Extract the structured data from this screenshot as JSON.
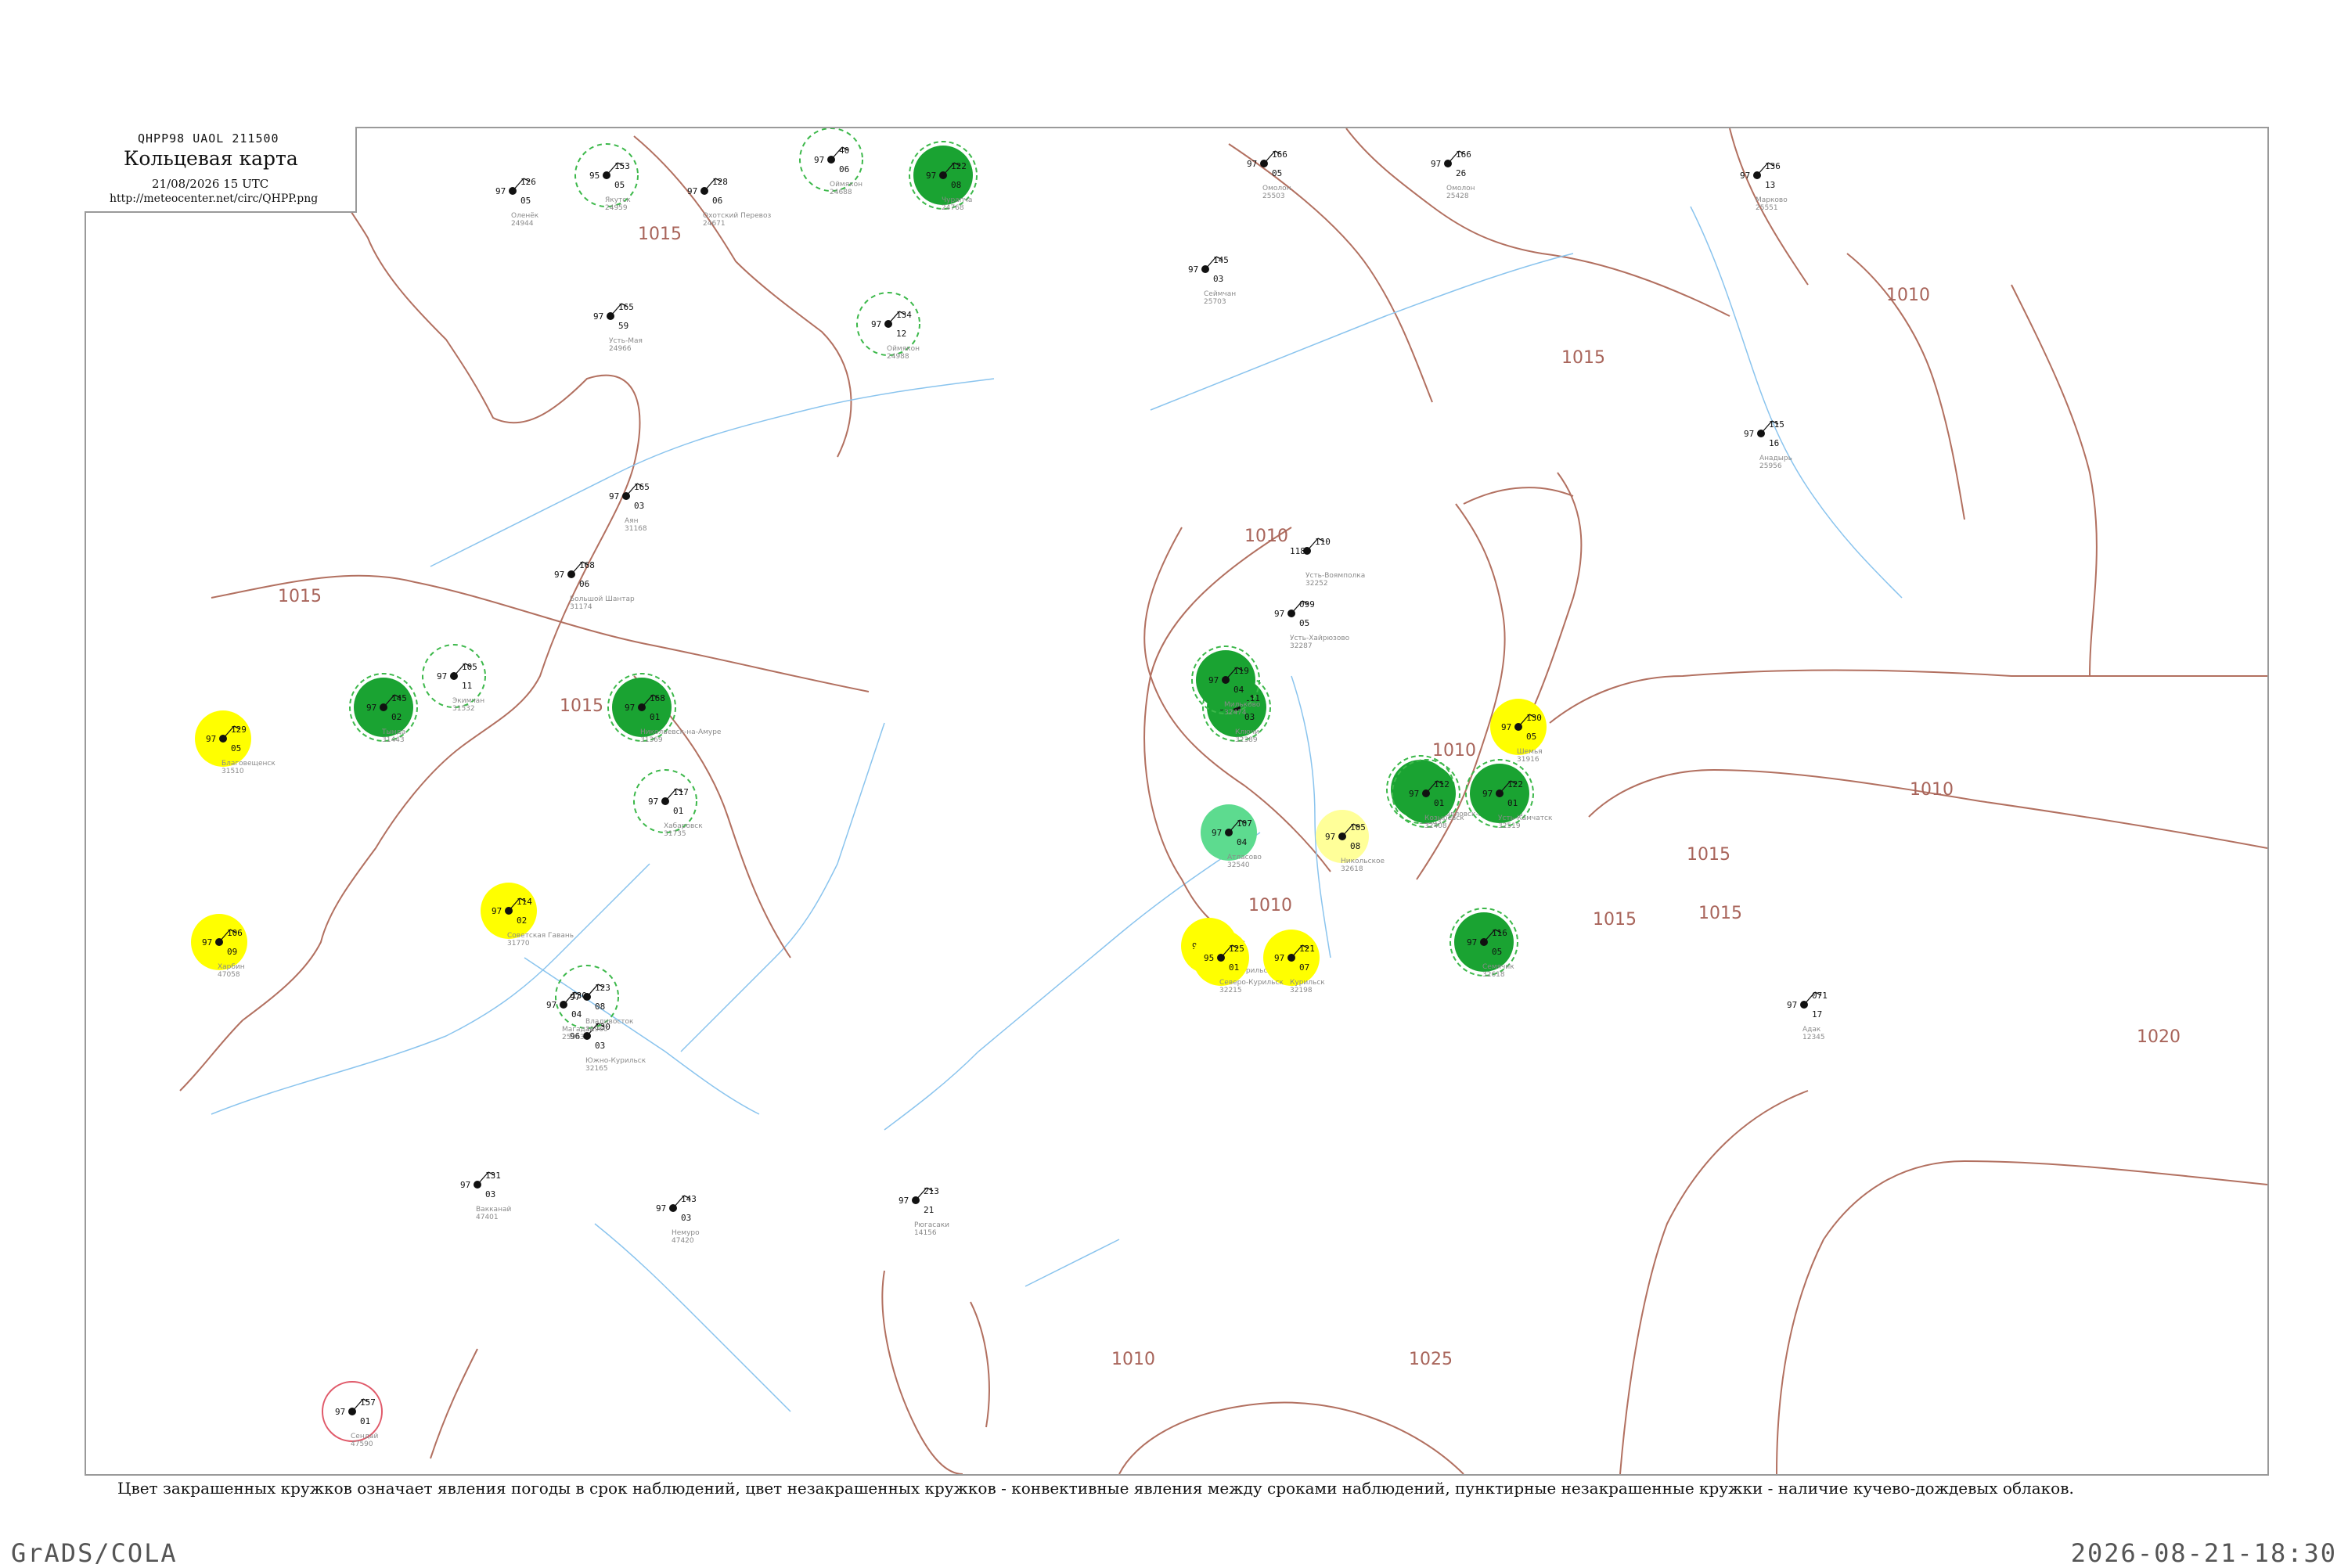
{
  "header": {
    "code_line": "QHPP98  UAOL  211500",
    "title": "Кольцевая карта",
    "datetime": "21/08/2026 15 UTC",
    "url": "http://meteocenter.net/circ/QHPP.png"
  },
  "caption": "Цвет закрашенных кружков означает явления погоды в срок наблюдений, цвет незакрашенных кружков - конвективные явления между сроками наблюдений, пунктирные незакрашенные кружки - наличие кучево-дождевых облаков.",
  "footer": {
    "left": "GrADS/COLA",
    "right": "2026-08-21-18:30"
  },
  "colors": {
    "isobar": "#b27060",
    "coast": "#b27060",
    "river": "#8ac4ee",
    "thunder_green": "#1aa332",
    "light_green": "#5ddb8f",
    "yellow": "#ffff00",
    "pale_yellow": "#ffff99",
    "dashed_green": "#3cb84a",
    "red_ring": "#e05a6a"
  },
  "isobar_labels": [
    {
      "text": "1015"
    },
    {
      "text": "1015"
    },
    {
      "text": "1010"
    },
    {
      "text": "1015"
    },
    {
      "text": "1010"
    },
    {
      "text": "1015"
    },
    {
      "text": "1010"
    },
    {
      "text": "1010"
    },
    {
      "text": "1015"
    },
    {
      "text": "1020"
    },
    {
      "text": "1025"
    },
    {
      "text": "1010"
    },
    {
      "text": "1010"
    },
    {
      "text": "1015"
    },
    {
      "text": "1015"
    }
  ],
  "stations": [
    {
      "id": "24959",
      "name": "Якутск",
      "marker": "dashed",
      "v": [
        "153",
        "95",
        "05"
      ]
    },
    {
      "id": "24944",
      "name": "Оленёк",
      "marker": "none",
      "v": [
        "126",
        "97",
        "05"
      ]
    },
    {
      "id": "24671",
      "name": "Охотский Перевоз",
      "marker": "none",
      "v": [
        "128",
        "97",
        "06"
      ]
    },
    {
      "id": "24688",
      "name": "Оймякон",
      "marker": "dashed",
      "v": [
        "40",
        "97",
        "06"
      ]
    },
    {
      "id": "25503",
      "name": "Омолон",
      "marker": "none",
      "v": [
        "166",
        "97",
        "05"
      ]
    },
    {
      "id": "25428",
      "name": "Омолон",
      "marker": "none",
      "v": [
        "166",
        "97",
        "26"
      ]
    },
    {
      "id": "25551",
      "name": "Марково",
      "marker": "none",
      "v": [
        "136",
        "97",
        "13"
      ]
    },
    {
      "id": "24768",
      "name": "Чурапча",
      "marker": "green",
      "v": [
        "122",
        "97",
        "08"
      ]
    },
    {
      "id": "24966",
      "name": "Усть-Мая",
      "marker": "none",
      "v": [
        "165",
        "97",
        "59"
      ]
    },
    {
      "id": "24988",
      "name": "Оймякон",
      "marker": "dashed",
      "v": [
        "134",
        "97",
        "12"
      ]
    },
    {
      "id": "31168",
      "name": "Аян",
      "marker": "none",
      "v": [
        "165",
        "97",
        "03"
      ]
    },
    {
      "id": "31174",
      "name": "Большой Шантар",
      "marker": "none",
      "v": [
        "168",
        "97",
        "06"
      ]
    },
    {
      "id": "25703",
      "name": "Сеймчан",
      "marker": "none",
      "v": [
        "145",
        "97",
        "03"
      ]
    },
    {
      "id": "32389",
      "name": "Ключи",
      "marker": "green",
      "v": [
        "111",
        "97",
        "03"
      ]
    },
    {
      "id": "32098",
      "name": "Северо-Курильск",
      "marker": "yellow",
      "v": [
        "124",
        "97",
        "07"
      ]
    },
    {
      "id": "31369",
      "name": "Николаевск-на-Амуре",
      "marker": "green",
      "v": [
        "168",
        "97",
        "01"
      ]
    },
    {
      "id": "31770",
      "name": "Советская Гавань",
      "marker": "yellow",
      "v": [
        "114",
        "97",
        "02"
      ]
    },
    {
      "id": "32165",
      "name": "Южно-Курильск",
      "marker": "none",
      "v": [
        "130",
        "96",
        "03"
      ]
    },
    {
      "id": "31510",
      "name": "Благовещенск",
      "marker": "yellow",
      "v": [
        "129",
        "97",
        "05"
      ]
    },
    {
      "id": "31443",
      "name": "Тында",
      "marker": "green",
      "v": [
        "145",
        "97",
        "02"
      ]
    },
    {
      "id": "31532",
      "name": "Экимчан",
      "marker": "dashed",
      "v": [
        "105",
        "97",
        "11"
      ]
    },
    {
      "id": "31735",
      "name": "Хабаровск",
      "marker": "dashed",
      "v": [
        "117",
        "97",
        "01"
      ]
    },
    {
      "id": "31960",
      "name": "Владивосток",
      "marker": "dashed",
      "v": [
        "123",
        "97",
        "08"
      ]
    },
    {
      "id": "47058",
      "name": "Харбин",
      "marker": "yellow",
      "v": [
        "106",
        "97",
        "09"
      ]
    },
    {
      "id": "32583",
      "name": "Петропавловск-Камчатский",
      "marker": "green",
      "v": [
        "110",
        "97",
        "07"
      ]
    },
    {
      "id": "32618",
      "name": "Никольское",
      "marker": "pale",
      "v": [
        "105",
        "97",
        "08"
      ]
    },
    {
      "id": "25913",
      "name": "Магадан",
      "marker": "none",
      "v": [
        "130",
        "97",
        "04"
      ]
    },
    {
      "id": "32287",
      "name": "Усть-Хайрюзово",
      "marker": "none",
      "v": [
        "099",
        "97",
        "05"
      ]
    },
    {
      "id": "32252",
      "name": "Усть-Воямполка",
      "marker": "none",
      "v": [
        "110",
        "118",
        ""
      ]
    },
    {
      "id": "32408",
      "name": "Козыревск",
      "marker": "green",
      "v": [
        "112",
        "97",
        "01"
      ]
    },
    {
      "id": "32519",
      "name": "Усть-Камчатск",
      "marker": "green",
      "v": [
        "122",
        "97",
        "01"
      ]
    },
    {
      "id": "32618",
      "name": "Семячик",
      "marker": "green",
      "v": [
        "116",
        "97",
        "05"
      ]
    },
    {
      "id": "32474",
      "name": "Мильково",
      "marker": "green",
      "v": [
        "119",
        "97",
        "04"
      ]
    },
    {
      "id": "32540",
      "name": "Атласово",
      "marker": "lightgreen",
      "v": [
        "107",
        "97",
        "04"
      ]
    },
    {
      "id": "32198",
      "name": "Курильск",
      "marker": "yellow",
      "v": [
        "121",
        "97",
        "07"
      ]
    },
    {
      "id": "32215",
      "name": "Северо-Курильск",
      "marker": "yellow",
      "v": [
        "125",
        "95",
        "01"
      ]
    },
    {
      "id": "25956",
      "name": "Анадырь",
      "marker": "none",
      "v": [
        "115",
        "97",
        "16"
      ]
    },
    {
      "id": "31916",
      "name": "Шемья",
      "marker": "yellow",
      "v": [
        "130",
        "97",
        "05"
      ]
    },
    {
      "id": "12345",
      "name": "Адак",
      "marker": "none",
      "v": [
        "071",
        "97",
        "17"
      ]
    },
    {
      "id": "14156",
      "name": "Рюгасаки",
      "marker": "none",
      "v": [
        "213",
        "97",
        "21"
      ]
    },
    {
      "id": "47420",
      "name": "Немуро",
      "marker": "none",
      "v": [
        "143",
        "97",
        "03"
      ]
    },
    {
      "id": "47401",
      "name": "Вакканай",
      "marker": "none",
      "v": [
        "131",
        "97",
        "03"
      ]
    },
    {
      "id": "47590",
      "name": "Сендай",
      "marker": "red",
      "v": [
        "157",
        "97",
        "01"
      ]
    }
  ]
}
